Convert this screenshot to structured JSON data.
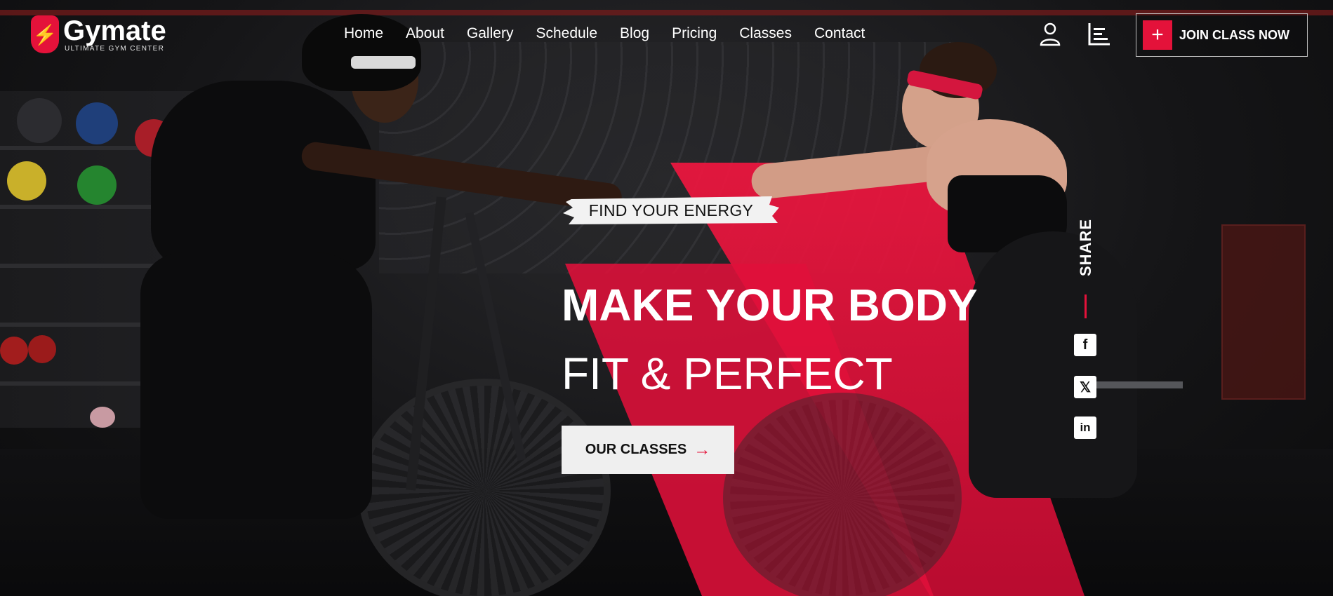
{
  "brand": {
    "name": "Gymate",
    "tagline": "ULTIMATE GYM CENTER",
    "accent_color": "#e4123a"
  },
  "nav": {
    "items": [
      {
        "label": "Home"
      },
      {
        "label": "About"
      },
      {
        "label": "Gallery"
      },
      {
        "label": "Schedule"
      },
      {
        "label": "Blog"
      },
      {
        "label": "Pricing"
      },
      {
        "label": "Classes"
      },
      {
        "label": "Contact"
      }
    ]
  },
  "header": {
    "account_icon": "user-icon",
    "menu_icon": "bars-icon",
    "join_button": {
      "icon": "plus-icon",
      "label": "JOIN CLASS NOW"
    }
  },
  "hero": {
    "tag": "FIND YOUR ENERGY",
    "headline_line1": "MAKE YOUR BODY",
    "headline_line2": "FIT & PERFECT",
    "cta": {
      "label": "OUR CLASSES",
      "icon": "arrow-right-icon"
    }
  },
  "share": {
    "label": "SHARE",
    "networks": [
      {
        "name": "facebook",
        "icon": "facebook-icon"
      },
      {
        "name": "x",
        "icon": "x-icon"
      },
      {
        "name": "linkedin",
        "icon": "linkedin-icon"
      }
    ]
  }
}
